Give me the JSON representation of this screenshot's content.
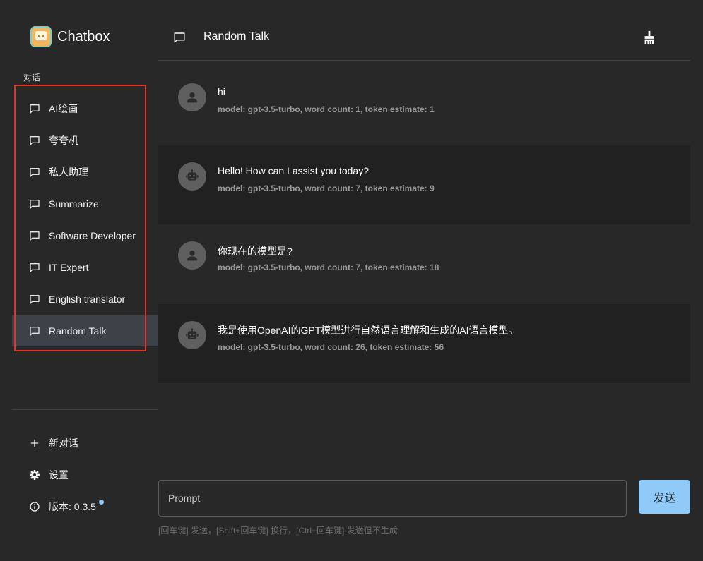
{
  "app": {
    "name": "Chatbox"
  },
  "sidebar": {
    "section_label": "对话",
    "conversations": [
      {
        "label": "AI绘画"
      },
      {
        "label": "夸夸机"
      },
      {
        "label": "私人助理"
      },
      {
        "label": "Summarize"
      },
      {
        "label": "Software Developer"
      },
      {
        "label": "IT Expert"
      },
      {
        "label": "English translator"
      },
      {
        "label": "Random Talk"
      }
    ],
    "new_chat_label": "新对话",
    "settings_label": "设置",
    "version_label": "版本: 0.3.5"
  },
  "header": {
    "title": "Random Talk"
  },
  "messages": [
    {
      "role": "user",
      "text": "hi",
      "meta": "model: gpt-3.5-turbo, word count: 1, token estimate: 1"
    },
    {
      "role": "assistant",
      "text": "Hello! How can I assist you today?",
      "meta": "model: gpt-3.5-turbo, word count: 7, token estimate: 9"
    },
    {
      "role": "user",
      "text": "你现在的模型是?",
      "meta": "model: gpt-3.5-turbo, word count: 7, token estimate: 18"
    },
    {
      "role": "assistant",
      "text": "我是使用OpenAI的GPT模型进行自然语言理解和生成的AI语言模型。",
      "meta": "model: gpt-3.5-turbo, word count: 26, token estimate: 56"
    }
  ],
  "input": {
    "placeholder": "Prompt",
    "value": ""
  },
  "send_label": "发送",
  "hint": "[回车键] 发送，[Shift+回车键] 换行，[Ctrl+回车键] 发送但不生成",
  "colors": {
    "accent": "#90caf9",
    "highlight_box": "#e5332a",
    "active_item": "#3d4148"
  },
  "icons": {
    "logo": "chatbox-logo-icon",
    "conversation": "chat-bubble-icon",
    "clean": "broom-icon",
    "user_avatar": "person-icon",
    "bot_avatar": "robot-icon",
    "new_chat": "plus-icon",
    "settings": "gear-icon",
    "version": "info-icon"
  }
}
